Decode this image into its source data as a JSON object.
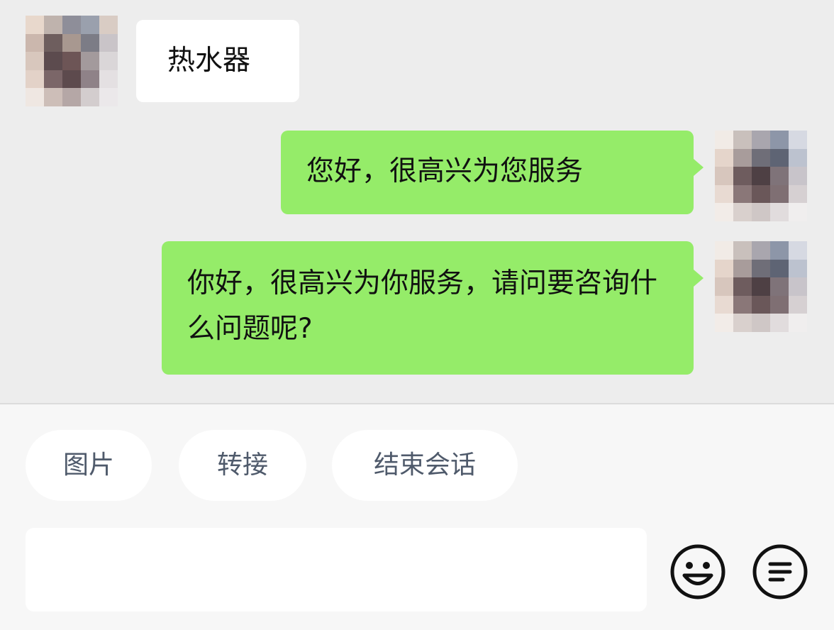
{
  "messages": [
    {
      "sender": "other",
      "text": "热水器"
    },
    {
      "sender": "self",
      "text": "您好，很高兴为您服务"
    },
    {
      "sender": "self",
      "text": "你好，很高兴为你服务，请问要咨询什么问题呢?"
    }
  ],
  "quick_actions": {
    "image": "图片",
    "transfer": "转接",
    "end_session": "结束会话"
  },
  "input": {
    "value": "",
    "placeholder": ""
  },
  "icons": {
    "emoji": "smile-emoji-icon",
    "menu": "list-menu-icon"
  },
  "colors": {
    "chat_background": "#ededed",
    "incoming_bubble": "#ffffff",
    "outgoing_bubble": "#95ec69",
    "panel_background": "#f7f7f7",
    "chip_text": "#4f5a6b"
  }
}
